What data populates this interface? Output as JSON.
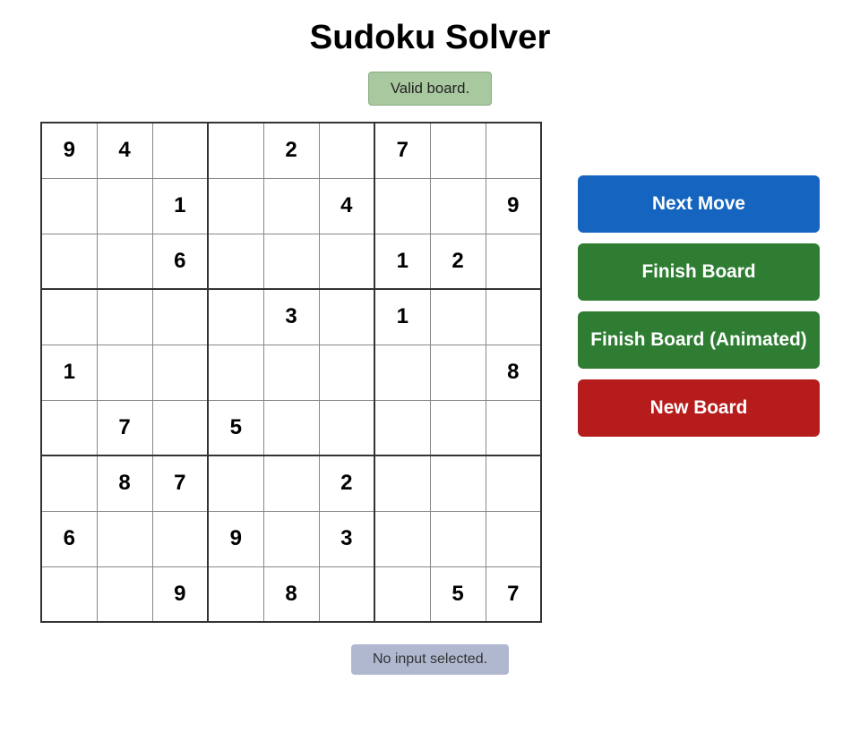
{
  "title": "Sudoku Solver",
  "status": "Valid board.",
  "no_input": "No input selected.",
  "buttons": {
    "next_move": "Next Move",
    "finish_board": "Finish Board",
    "finish_board_animated": "Finish Board (Animated)",
    "new_board": "New Board"
  },
  "grid": [
    [
      "9",
      "4",
      "",
      "",
      "2",
      "",
      "7",
      "",
      ""
    ],
    [
      "",
      "",
      "1",
      "",
      "",
      "4",
      "",
      "",
      "9"
    ],
    [
      "",
      "",
      "6",
      "",
      "",
      "",
      "1",
      "2",
      ""
    ],
    [
      "",
      "",
      "",
      "",
      "3",
      "",
      "1",
      "",
      ""
    ],
    [
      "1",
      "",
      "",
      "",
      "",
      "",
      "",
      "",
      "8"
    ],
    [
      "",
      "7",
      "",
      "5",
      "",
      "",
      "",
      "",
      ""
    ],
    [
      "",
      "8",
      "7",
      "",
      "",
      "2",
      "",
      "",
      ""
    ],
    [
      "6",
      "",
      "",
      "9",
      "",
      "3",
      "",
      "",
      ""
    ],
    [
      "",
      "",
      "9",
      "",
      "8",
      "",
      "",
      "5",
      "7"
    ]
  ]
}
